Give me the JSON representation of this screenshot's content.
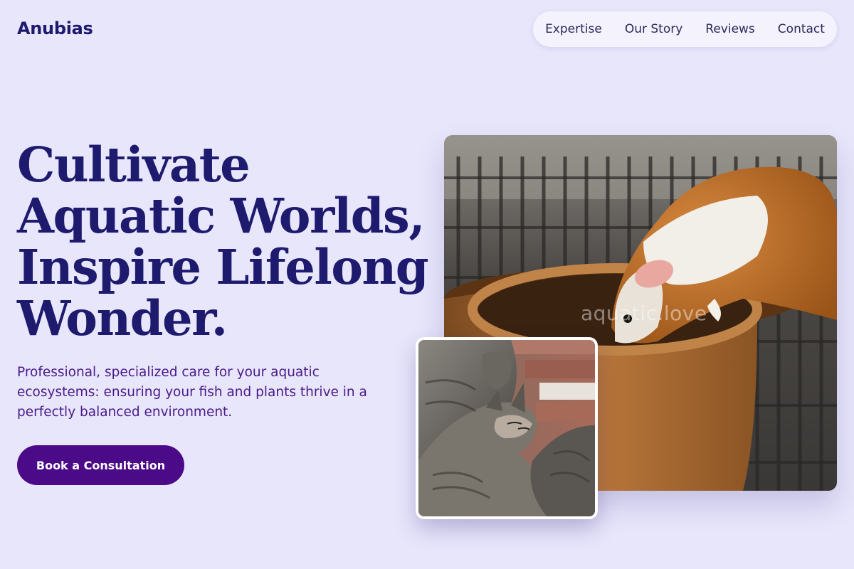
{
  "header": {
    "logo": "Anubias",
    "nav": [
      {
        "label": "Expertise"
      },
      {
        "label": "Our Story"
      },
      {
        "label": "Reviews"
      },
      {
        "label": "Contact"
      }
    ]
  },
  "hero": {
    "headline_lines": [
      "Cultivate",
      "Aquatic Worlds,",
      "Inspire Lifelong",
      "Wonder."
    ],
    "subtext": "Professional, specialized care for your aquatic ecosystems: ensuring your fish and plants thrive in a perfectly balanced environment.",
    "cta_label": "Book a Consultation"
  },
  "images": {
    "main_watermark": "aquatic.love"
  },
  "colors": {
    "background": "#e8e6fb",
    "brand": "#1e1b6e",
    "accent": "#4b0a87",
    "subtext": "#4a1a8a"
  }
}
